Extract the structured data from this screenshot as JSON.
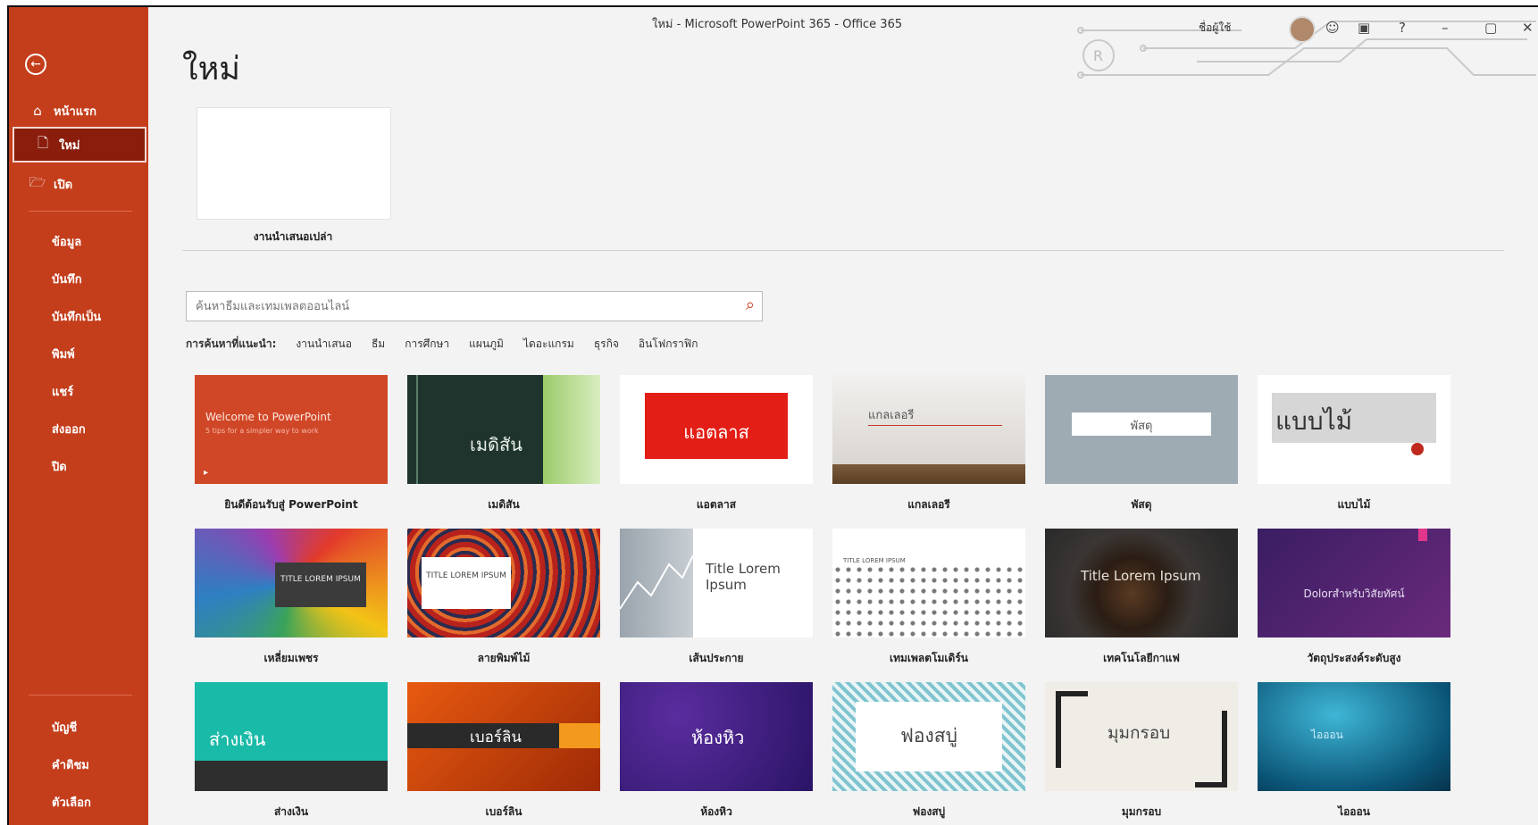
{
  "window": {
    "title": "ใหม่ - Microsoft PowerPoint 365 - Office 365"
  },
  "user": {
    "name": "ชื่อผู้ใช้"
  },
  "controls": {
    "help": "?",
    "minimize": "–",
    "restore": "▢",
    "close": "✕"
  },
  "sidebar": {
    "top": [
      {
        "label": "หน้าแรก",
        "icon": "home-icon"
      },
      {
        "label": "ใหม่",
        "icon": "new-file-icon"
      },
      {
        "label": "เปิด",
        "icon": "open-folder-icon"
      }
    ],
    "middle": [
      "ข้อมูล",
      "บันทึก",
      "บันทึกเป็น",
      "พิมพ์",
      "แชร์",
      "ส่งออก",
      "ปิด"
    ],
    "bottom": [
      "บัญชี",
      "คำติชม",
      "ตัวเลือก"
    ]
  },
  "page": {
    "title": "ใหม่",
    "blank_label": "งานนำเสนอเปล่า"
  },
  "search": {
    "placeholder": "ค้นหาธีมและเทมเพลตออนไลน์",
    "suggest_label": "การค้นหาที่แนะนำ:",
    "suggestions": [
      "งานนำเสนอ",
      "ธีม",
      "การศึกษา",
      "แผนภูมิ",
      "ไดอะแกรม",
      "ธุรกิจ",
      "อินโฟกราฟิก"
    ]
  },
  "templates": [
    {
      "label": "ยินดีต้อนรับสู่ PowerPoint",
      "thumb": "Welcome to PowerPoint",
      "thumb_sub": "5 tips for a simpler way to work"
    },
    {
      "label": "เมดิสัน",
      "thumb": "เมดิสัน"
    },
    {
      "label": "แอตลาส",
      "thumb": "แอตลาส"
    },
    {
      "label": "แกลเลอรี",
      "thumb": "แกลเลอรี"
    },
    {
      "label": "พัสดุ",
      "thumb": "พัสดุ"
    },
    {
      "label": "แบบไม้",
      "thumb": "แบบไม้"
    },
    {
      "label": "เหลี่ยมเพชร",
      "thumb": "TITLE LOREM IPSUM"
    },
    {
      "label": "ลายพิมพ์ไม้",
      "thumb": "TITLE LOREM IPSUM"
    },
    {
      "label": "เส้นประกาย",
      "thumb": "Title Lorem Ipsum"
    },
    {
      "label": "เทมเพลตโมเดิร์น",
      "thumb": "TITLE LOREM IPSUM"
    },
    {
      "label": "เทคโนโลยีกาแฟ",
      "thumb": "Title Lorem Ipsum"
    },
    {
      "label": "วัตถุประสงค์ระดับสูง",
      "thumb": "Dolorสำหรับวิสัยทัศน์"
    },
    {
      "label": "ส่างเงิน",
      "thumb": "ส่างเงิน"
    },
    {
      "label": "เบอร์ลิน",
      "thumb": "เบอร์ลิน"
    },
    {
      "label": "ห้องหิว",
      "thumb": "ห้องหิว"
    },
    {
      "label": "ฟองสบู่",
      "thumb": "ฟองสบู่"
    },
    {
      "label": "มุมกรอบ",
      "thumb": "มุมกรอบ"
    },
    {
      "label": "ไอออน",
      "thumb": "ไอออน"
    }
  ]
}
